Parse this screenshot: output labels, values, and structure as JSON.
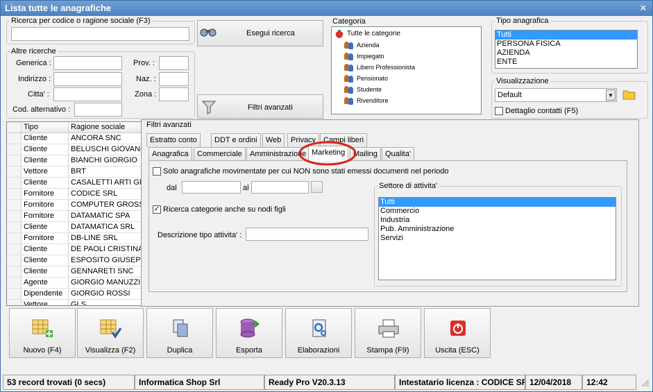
{
  "window": {
    "title": "Lista tutte le anagrafiche"
  },
  "search": {
    "legend": "Ricerca per codice o ragione sociale (F3)",
    "value": "",
    "execute_label": "Esegui ricerca"
  },
  "altre": {
    "legend": "Altre ricerche",
    "generica": "Generica :",
    "indirizzo": "Indirizzo :",
    "citta": "Citta' :",
    "cod_alt": "Cod. alternativo :",
    "prov": "Prov. :",
    "naz": "Naz. :",
    "zona": "Zona :"
  },
  "filtri_btn": "Filtri avanzati",
  "categoria": {
    "legend": "Categoria",
    "root": "Tutte le categorie",
    "items": [
      "Azienda",
      "Impiegato",
      "Libero Professionista",
      "Pensionato",
      "Studente",
      "Rivenditore"
    ]
  },
  "tipo": {
    "legend": "Tipo anagrafica",
    "items": [
      "Tutti",
      "PERSONA FISICA",
      "AZIENDA",
      "ENTE"
    ],
    "selected": "Tutti"
  },
  "visual": {
    "legend": "Visualizzazione",
    "value": "Default",
    "dettaglio": "Dettaglio contatti (F5)"
  },
  "grid": {
    "headers": [
      "Tipo",
      "Ragione sociale"
    ],
    "rows": [
      [
        "Cliente",
        "ANCORA SNC"
      ],
      [
        "Cliente",
        "BELUSCHI GIOVANNI"
      ],
      [
        "Cliente",
        "BIANCHI GIORGIO"
      ],
      [
        "Vettore",
        "BRT"
      ],
      [
        "Cliente",
        "CASALETTI ARTI GRA"
      ],
      [
        "Fornitore",
        "CODICE SRL"
      ],
      [
        "Fornitore",
        "COMPUTER GROSS SR"
      ],
      [
        "Fornitore",
        "DATAMATIC SPA"
      ],
      [
        "Cliente",
        "DATAMATICA SRL"
      ],
      [
        "Fornitore",
        "DB-LINE SRL"
      ],
      [
        "Cliente",
        "DE PAOLI CRISTINA"
      ],
      [
        "Cliente",
        "ESPOSITO GIUSEPPE"
      ],
      [
        "Cliente",
        "GENNARETI SNC"
      ],
      [
        "Agente",
        "GIORGIO MANUZZI (C"
      ],
      [
        "Dipendente",
        "GIORGIO ROSSI"
      ],
      [
        "Vettore",
        "GLS"
      ]
    ]
  },
  "filtri": {
    "title": "Filtri avanzati",
    "tabs_top": [
      "Estratto conto",
      "DDT e ordini",
      "Web",
      "Privacy",
      "Campi liberi"
    ],
    "tabs_bottom": [
      "Anagrafica",
      "Commerciale",
      "Amministrazione",
      "Marketing",
      "Mailing",
      "Qualita'"
    ],
    "active_tab": "Marketing",
    "solo_label": "Solo anagrafiche movimentate per cui NON sono stati emessi documenti nel periodo",
    "dal": "dal",
    "al": "al",
    "ricerca_cat": "Ricerca categorie anche su nodi figli",
    "descrizione": "Descrizione tipo attivita' :",
    "settore_legend": "Settore di attivita'",
    "settore_items": [
      "Tutti",
      "Commercio",
      "Industria",
      "Pub. Amministrazione",
      "Servizi"
    ]
  },
  "toolbar": [
    "Nuovo (F4)",
    "Visualizza (F2)",
    "Duplica",
    "Esporta",
    "Elaborazioni",
    "Stampa (F9)",
    "Uscita (ESC)"
  ],
  "status": {
    "records": "53 record trovati (0 secs)",
    "company": "Informatica Shop Srl",
    "version": "Ready Pro V20.3.13",
    "license": "Intestatario licenza : CODICE SRL",
    "date": "12/04/2018",
    "time": "12:42"
  },
  "colors": {
    "title_bar": "#4d82c0",
    "selection": "#3399ff",
    "highlight_circle": "#e02020"
  }
}
